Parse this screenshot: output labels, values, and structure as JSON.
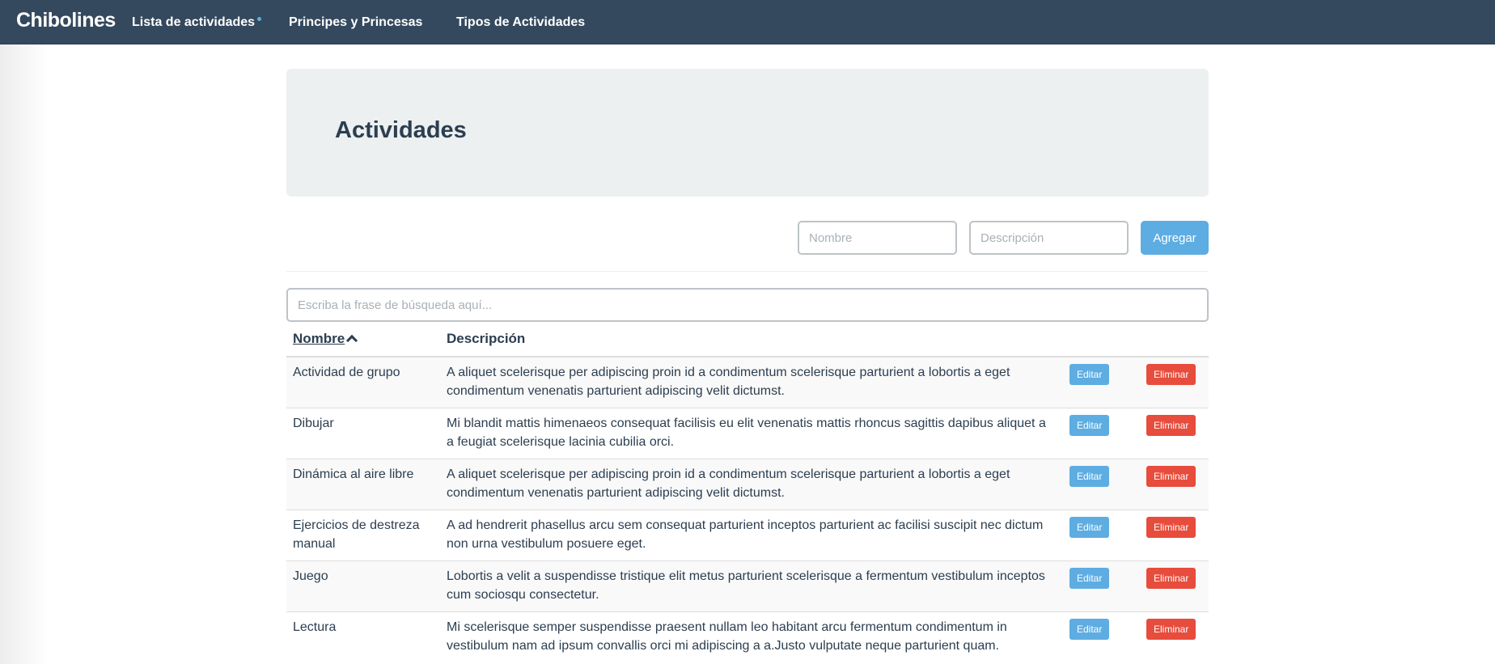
{
  "navbar": {
    "brand": "Chibolines",
    "links": [
      {
        "label": "Lista de actividades",
        "active": true
      },
      {
        "label": "Principes y Princesas"
      },
      {
        "label": "Tipos de Actividades"
      }
    ]
  },
  "header": {
    "title": "Actividades"
  },
  "form": {
    "name_placeholder": "Nombre",
    "description_placeholder": "Descripción",
    "add_label": "Agregar"
  },
  "search": {
    "placeholder": "Escriba la frase de búsqueda aquí..."
  },
  "table": {
    "columns": {
      "name": "Nombre",
      "description": "Descripción"
    },
    "sort": {
      "column": "name",
      "direction": "asc"
    },
    "edit_label": "Editar",
    "delete_label": "Eliminar",
    "rows": [
      {
        "name": "Actividad de grupo",
        "description": "A aliquet scelerisque per adipiscing proin id a condimentum scelerisque parturient a lobortis a eget condimentum venenatis parturient adipiscing velit dictumst."
      },
      {
        "name": "Dibujar",
        "description": "Mi blandit mattis himenaeos consequat facilisis eu elit venenatis mattis rhoncus sagittis dapibus aliquet a a feugiat scelerisque lacinia cubilia orci."
      },
      {
        "name": "Dinámica al aire libre",
        "description": "A aliquet scelerisque per adipiscing proin id a condimentum scelerisque parturient a lobortis a eget condimentum venenatis parturient adipiscing velit dictumst."
      },
      {
        "name": "Ejercicios de destreza manual",
        "description": "A ad hendrerit phasellus arcu sem consequat parturient inceptos parturient ac facilisi suscipit nec dictum non urna vestibulum posuere eget."
      },
      {
        "name": "Juego",
        "description": "Lobortis a velit a suspendisse tristique elit metus parturient scelerisque a fermentum vestibulum inceptos cum sociosqu consectetur."
      },
      {
        "name": "Lectura",
        "description": "Mi scelerisque semper suspendisse praesent nullam leo habitant arcu fermentum condimentum in vestibulum nam ad ipsum convallis orci mi adipiscing a a.Justo vulputate neque parturient quam."
      }
    ]
  },
  "colors": {
    "navbar": "#34495e",
    "primary": "#5dade2",
    "danger": "#e74c3c",
    "text": "#2c3e50",
    "jumbotron": "#ecf0f1"
  }
}
